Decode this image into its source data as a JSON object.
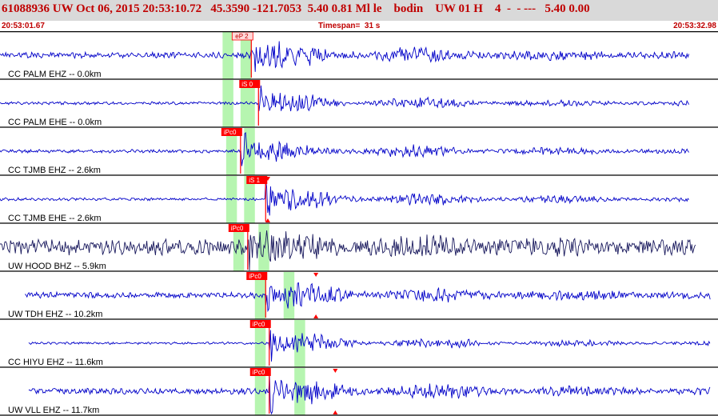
{
  "header": {
    "title": "61088936 UW Oct 06, 2015 20:53:10.72   45.3590 -121.7053  5.40 0.81 Ml le    bodin    UW 01 H    4  -  - ---   5.40 0.00",
    "start_time": "20:53:01.67",
    "timespan": "Timespan=  31 s",
    "end_time": "20:53:32.98"
  },
  "colors": {
    "trace": "#0000c8",
    "trace_dark": "#1a1a5e",
    "window": "#b6f5b0",
    "pick": "#ff0000",
    "header_text": "#c00000",
    "header_bg": "#d9d9d9"
  },
  "traces": [
    {
      "label": "CC PALM EHZ -- 0.0km",
      "pick": "eP 2",
      "pick_style": "outline",
      "start": 0.0,
      "end": 0.96,
      "onset": 0.35,
      "noise": 0.12,
      "amp": 0.55,
      "seed": 11,
      "dark": false,
      "win": [
        0.31,
        0.325,
        0.335,
        0.35
      ],
      "tri": []
    },
    {
      "label": "CC PALM EHE -- 0.0km",
      "pick": "iS 0",
      "pick_style": "filled",
      "start": 0.0,
      "end": 0.96,
      "onset": 0.36,
      "noise": 0.06,
      "amp": 0.45,
      "seed": 23,
      "dark": false,
      "win": [
        0.31,
        0.325,
        0.335,
        0.355
      ],
      "tri": []
    },
    {
      "label": "CC TJMB EHZ -- 2.6km",
      "pick": "iPc0",
      "pick_style": "filled",
      "start": 0.0,
      "end": 0.96,
      "onset": 0.335,
      "noise": 0.07,
      "amp": 0.45,
      "seed": 37,
      "dark": false,
      "win": [
        0.315,
        0.33,
        0.34,
        0.355
      ],
      "tri": []
    },
    {
      "label": "CC TJMB EHE -- 2.6km",
      "pick": "iS 1",
      "pick_style": "filled",
      "start": 0.0,
      "end": 0.96,
      "onset": 0.37,
      "noise": 0.06,
      "amp": 0.5,
      "seed": 41,
      "dark": false,
      "win": [
        0.315,
        0.33,
        0.34,
        0.355
      ],
      "tri": [
        0.373
      ]
    },
    {
      "label": "UW HOOD BHZ -- 5.9km",
      "pick": "iPc0",
      "pick_style": "filled",
      "start": 0.0,
      "end": 0.97,
      "onset": 0.345,
      "noise": 0.32,
      "amp": 0.45,
      "seed": 53,
      "dark": true,
      "win": [
        0.325,
        0.34,
        0.36,
        0.375
      ],
      "tri": []
    },
    {
      "label": "UW TDH EHZ -- 10.2km",
      "pick": "iPc0",
      "pick_style": "filled",
      "start": 0.035,
      "end": 0.99,
      "onset": 0.37,
      "noise": 0.12,
      "amp": 0.5,
      "seed": 67,
      "dark": false,
      "win": [
        0.355,
        0.37,
        0.395,
        0.41
      ],
      "tri": [
        0.44
      ]
    },
    {
      "label": "CC HIYU EHZ -- 11.6km",
      "pick": "iPc0",
      "pick_style": "filled",
      "start": 0.04,
      "end": 0.99,
      "onset": 0.375,
      "noise": 0.05,
      "amp": 0.45,
      "seed": 79,
      "dark": false,
      "win": [
        0.355,
        0.37,
        0.41,
        0.425
      ],
      "tri": []
    },
    {
      "label": "UW VLL EHZ -- 11.7km",
      "pick": "iPc0",
      "pick_style": "filled",
      "start": 0.04,
      "end": 0.99,
      "onset": 0.375,
      "noise": 0.12,
      "amp": 0.5,
      "seed": 97,
      "dark": false,
      "win": [
        0.355,
        0.37,
        0.41,
        0.425
      ],
      "tri": [
        0.467
      ]
    }
  ]
}
